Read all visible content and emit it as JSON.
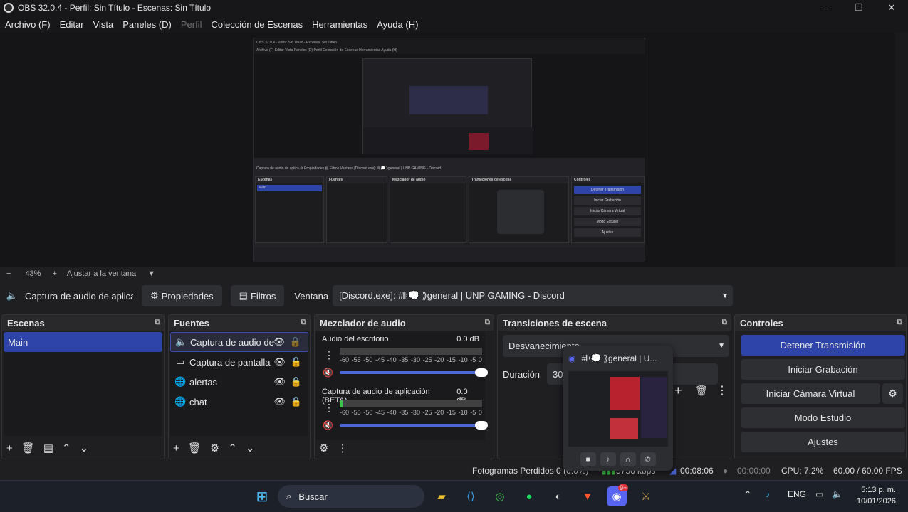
{
  "window": {
    "title": "OBS 32.0.4 - Perfil: Sin Título - Escenas: Sin Título",
    "minimize": "—",
    "maximize": "❐",
    "close": "✕"
  },
  "menu": [
    "Archivo (F)",
    "Editar",
    "Vista",
    "Paneles (D)",
    "Perfil",
    "Colección de Escenas",
    "Herramientas",
    "Ayuda (H)"
  ],
  "zoom": {
    "minus": "−",
    "value": "43%",
    "plus": "+",
    "fit": "Ajustar a la ventana",
    "arrow": "▼"
  },
  "source_bar": {
    "source_name": "Captura de audio de aplicación",
    "properties": "Propiedades",
    "filters": "Filtros",
    "window_label": "Ventana",
    "window_value": "[Discord.exe]: #𝄆💭 ⟫general | UNP GAMING - Discord"
  },
  "scenes": {
    "title": "Escenas",
    "items": [
      "Main"
    ]
  },
  "sources": {
    "title": "Fuentes",
    "items": [
      {
        "label": "Captura de audio de",
        "icon": "speaker-icon"
      },
      {
        "label": "Captura de pantalla",
        "icon": "monitor-icon"
      },
      {
        "label": "alertas",
        "icon": "globe-icon"
      },
      {
        "label": "chat",
        "icon": "globe-icon"
      }
    ]
  },
  "mixer": {
    "title": "Mezclador de audio",
    "channels": [
      {
        "name": "Audio del escritorio",
        "db": "0.0 dB"
      },
      {
        "name": "Captura de audio de aplicación (BETA)",
        "db": "0.0 dB"
      }
    ],
    "scale": [
      "-60",
      "-55",
      "-50",
      "-45",
      "-40",
      "-35",
      "-30",
      "-25",
      "-20",
      "-15",
      "-10",
      "-5",
      "0"
    ]
  },
  "transitions": {
    "title": "Transiciones de escena",
    "selected": "Desvanecimiento",
    "duration_label": "Duración",
    "duration_value": "300"
  },
  "controls": {
    "title": "Controles",
    "buttons": [
      "Detener Transmisión",
      "Iniciar Grabación",
      "Iniciar Cámara Virtual",
      "Modo Estudio",
      "Ajustes"
    ]
  },
  "status": {
    "dropped": "Fotogramas Perdidos 0 (0.0%)",
    "bitrate": "5756 kbps",
    "live_time": "00:08:06",
    "rec_time": "00:00:00",
    "cpu": "CPU: 7.2%",
    "fps": "60.00 / 60.00 FPS"
  },
  "discord_popup": {
    "title": "#𝄆💭 ⟫general | U...",
    "notif": "9+"
  },
  "taskbar": {
    "search": "Buscar",
    "lang": "ENG",
    "time": "5:13 p. m.",
    "date": "10/01/2026"
  },
  "nested": {
    "title": "OBS 32.0.4 - Perfil: Sin Título - Escenas: Sin Título",
    "menu": "Archivo (F)   Editar   Vista   Paneles (D)   Perfil   Colección de Escenas   Herramientas   Ayuda (H)",
    "bar": "Captura de audio de aplica   ⚙ Propiedades   ▤ Filtros   Ventana   [Discord.exe]: #𝄆💭 ⟫general | UNP GAMING - Discord",
    "scenes": "Escenas",
    "scene1": "Main",
    "sources": "Fuentes",
    "mixer": "Mezclador de audio",
    "transitions": "Transiciones de escena",
    "controls": "Controles",
    "c1": "Detener Transmisión",
    "c2": "Iniciar Grabación",
    "c3": "Iniciar Cámara Virtual",
    "c4": "Modo Estudio",
    "c5": "Ajustes"
  }
}
